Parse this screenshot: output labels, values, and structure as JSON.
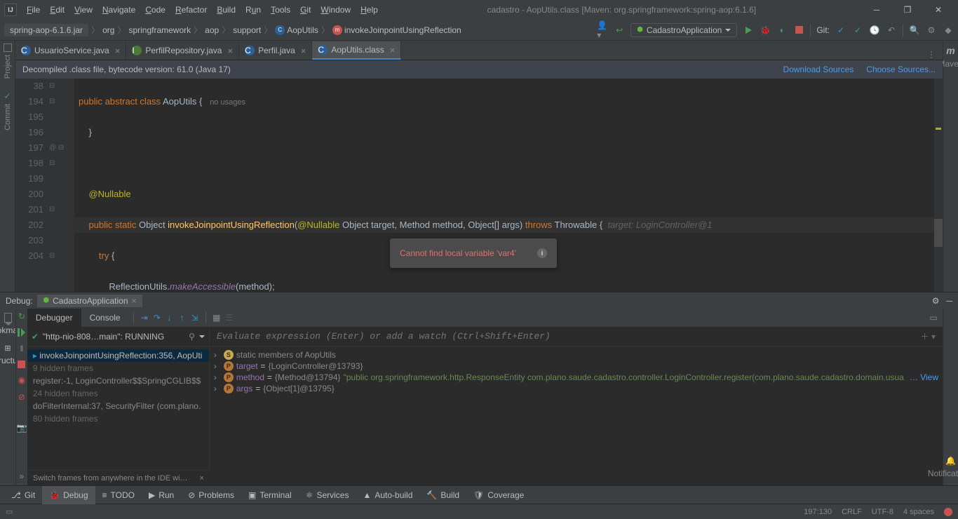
{
  "window": {
    "title": "cadastro - AopUtils.class [Maven: org.springframework:spring-aop:6.1.6]",
    "menus": [
      "File",
      "Edit",
      "View",
      "Navigate",
      "Code",
      "Refactor",
      "Build",
      "Run",
      "Tools",
      "Git",
      "Window",
      "Help"
    ]
  },
  "breadcrumb": {
    "jar": "spring-aop-6.1.6.jar",
    "pkg": [
      "org",
      "springframework",
      "aop",
      "support"
    ],
    "class": "AopUtils",
    "method": "invokeJoinpointUsingReflection"
  },
  "run_config": {
    "label": "CadastroApplication"
  },
  "toolbar_git_label": "Git:",
  "tabs": [
    {
      "label": "UsuarioService.java",
      "icon": "class"
    },
    {
      "label": "PerfilRepository.java",
      "icon": "interface"
    },
    {
      "label": "Perfil.java",
      "icon": "class"
    },
    {
      "label": "AopUtils.class",
      "icon": "class",
      "active": true
    }
  ],
  "banner": {
    "text": "Decompiled .class file, bytecode version: 61.0 (Java 17)",
    "link1": "Download Sources",
    "link2": "Choose Sources..."
  },
  "code": {
    "line_numbers": [
      "38",
      "194",
      "195",
      "196",
      "197",
      "198",
      "199",
      "200",
      "201",
      "202",
      "203",
      "204",
      ""
    ],
    "usages": "no usages",
    "inlay": "target: LoginController@1",
    "tooltip": "Cannot find local variable 'var4'"
  },
  "left_buttons": {
    "project": "Project",
    "commit": "Commit",
    "bookmarks": "Bookmarks",
    "structure": "Structure"
  },
  "right_buttons": {
    "maven": "Maven",
    "notifications": "Notifications"
  },
  "debug": {
    "header_label": "Debug:",
    "session": "CadastroApplication",
    "tabs": {
      "debugger": "Debugger",
      "console": "Console"
    },
    "thread": "\"http-nio-808…main\": RUNNING",
    "eval_placeholder": "Evaluate expression (Enter) or add a watch (Ctrl+Shift+Enter)",
    "frames": [
      {
        "text": "invokeJoinpointUsingReflection:356, AopUti",
        "sel": true
      },
      {
        "text": "9 hidden frames",
        "hidden": true
      },
      {
        "text": "register:-1, LoginController$$SpringCGLIB$$"
      },
      {
        "text": "24 hidden frames",
        "hidden": true
      },
      {
        "text": "doFilterInternal:37, SecurityFilter (com.plano."
      },
      {
        "text": "80 hidden frames",
        "hidden": true
      }
    ],
    "frames_hint": "Switch frames from anywhere in the IDE wi…",
    "vars": {
      "static": "static members of AopUtils",
      "target_name": "target",
      "target_val": "{LoginController@13793}",
      "method_name": "method",
      "method_val": "{Method@13794}",
      "method_str": "\"public org.springframework.http.ResponseEntity com.plano.saude.cadastro.controller.LoginController.register(com.plano.saude.cadastro.domain.usua",
      "method_view": "… View",
      "args_name": "args",
      "args_val": "{Object[1]@13795}"
    }
  },
  "bottom_tabs": {
    "git": "Git",
    "debug": "Debug",
    "todo": "TODO",
    "run": "Run",
    "problems": "Problems",
    "terminal": "Terminal",
    "services": "Services",
    "autobuild": "Auto-build",
    "build": "Build",
    "coverage": "Coverage"
  },
  "status": {
    "pos": "197:130",
    "crlf": "CRLF",
    "enc": "UTF-8",
    "indent": "4 spaces"
  }
}
